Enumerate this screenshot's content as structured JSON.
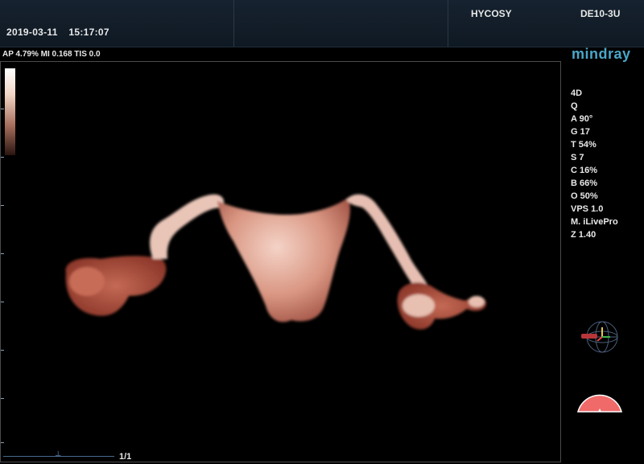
{
  "header": {
    "date": "2019-03-11",
    "time": "15:17:07",
    "exam_preset": "HYCOSY",
    "probe": "DE10-3U"
  },
  "acoustic_output": "AP 4.79%  MI 0.168 TIS 0.0",
  "brand": "mindray",
  "imaging_params": [
    "4D",
    "Q",
    "A 90°",
    "G 17",
    "T 54%",
    "S 7",
    "C 16%",
    "B 66%",
    "O 50%",
    "VPS 1.0",
    "M. iLivePro",
    "Z 1.40"
  ],
  "cine": {
    "frame_counter": "1/1"
  },
  "colors": {
    "background": "#000000",
    "topbar": "#13202c",
    "logo": "#4aa7c9",
    "render_tissue": "#d99a88",
    "fan_indicator": "#f06a6a"
  },
  "icons": {
    "orientation": "orientation-globe-icon",
    "fan": "fan-indicator-icon"
  }
}
